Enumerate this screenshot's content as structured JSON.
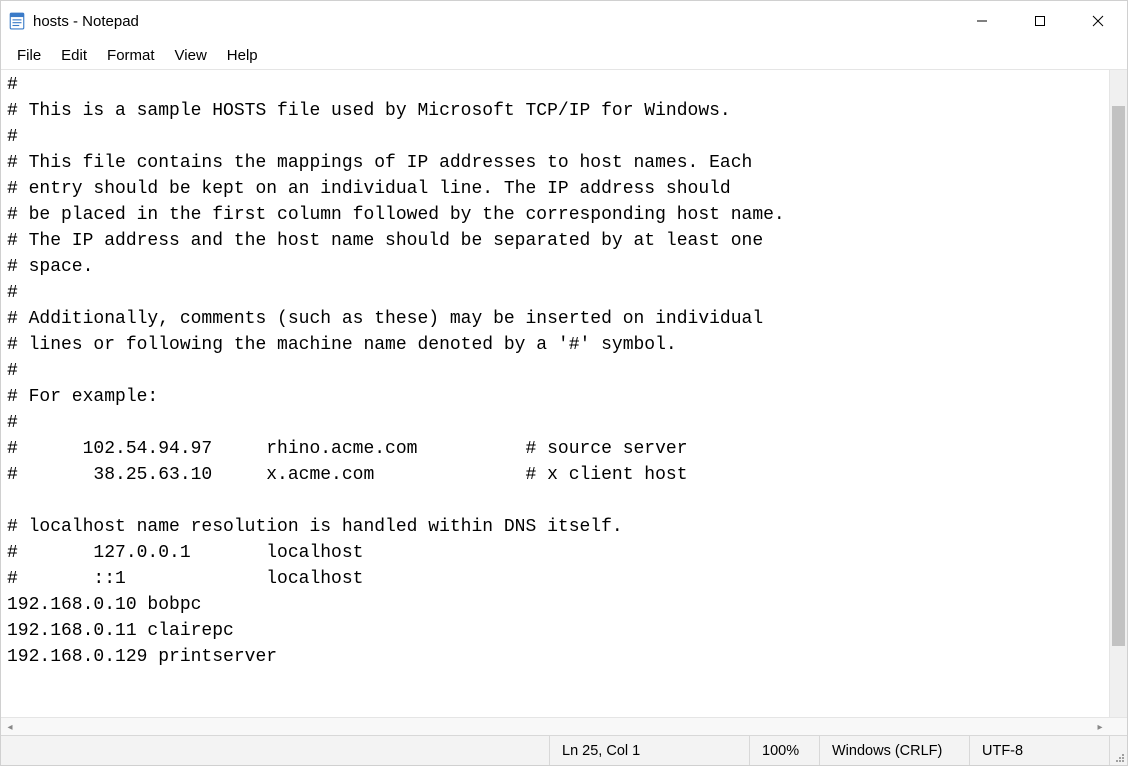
{
  "window": {
    "title": "hosts - Notepad"
  },
  "menu": {
    "items": [
      "File",
      "Edit",
      "Format",
      "View",
      "Help"
    ]
  },
  "editor": {
    "lines": [
      "#",
      "# This is a sample HOSTS file used by Microsoft TCP/IP for Windows.",
      "#",
      "# This file contains the mappings of IP addresses to host names. Each",
      "# entry should be kept on an individual line. The IP address should",
      "# be placed in the first column followed by the corresponding host name.",
      "# The IP address and the host name should be separated by at least one",
      "# space.",
      "#",
      "# Additionally, comments (such as these) may be inserted on individual",
      "# lines or following the machine name denoted by a '#' symbol.",
      "#",
      "# For example:",
      "#",
      "#      102.54.94.97     rhino.acme.com          # source server",
      "#       38.25.63.10     x.acme.com              # x client host",
      "",
      "# localhost name resolution is handled within DNS itself.",
      "#       127.0.0.1       localhost",
      "#       ::1             localhost",
      "192.168.0.10 bobpc",
      "192.168.0.11 clairepc",
      "192.168.0.129 printserver",
      ""
    ]
  },
  "status": {
    "position": "Ln 25, Col 1",
    "zoom": "100%",
    "line_ending": "Windows (CRLF)",
    "encoding": "UTF-8"
  }
}
